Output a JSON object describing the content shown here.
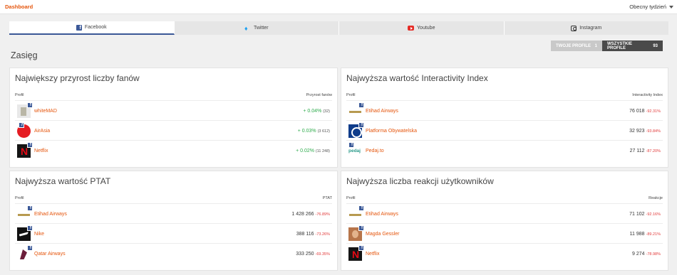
{
  "header": {
    "breadcrumb": "Dashboard",
    "period": "Obecny tydzień"
  },
  "tabs": [
    {
      "label": "Facebook",
      "icon": "facebook-icon",
      "active": true
    },
    {
      "label": "Twitter",
      "icon": "twitter-icon",
      "active": false
    },
    {
      "label": "Youtube",
      "icon": "youtube-icon",
      "active": false
    },
    {
      "label": "Instagram",
      "icon": "instagram-icon",
      "active": false
    }
  ],
  "toggle": {
    "own": {
      "label": "TWOJE PROFILE",
      "count": "1"
    },
    "all": {
      "label": "WSZYSTKIE PROFILE",
      "count": "93"
    }
  },
  "section_title": "Zasięg",
  "cards": [
    {
      "title": "Największy przyrost liczby fanów",
      "col_left": "Profil",
      "col_right": "Przyrost fanów",
      "rows": [
        {
          "name": "whiteMAD",
          "avatar": "whitemad-avatar",
          "value": "+ 0.04%",
          "aux": "(32)"
        },
        {
          "name": "AirAsia",
          "avatar": "airasia-avatar",
          "value": "+ 0.03%",
          "aux": "(3 612)"
        },
        {
          "name": "Netflix",
          "avatar": "netflix-avatar",
          "value": "+ 0.02%",
          "aux": "(11 248)"
        }
      ]
    },
    {
      "title": "Najwyższa wartość Interactivity Index",
      "col_left": "Profil",
      "col_right": "Interactivity Index",
      "rows": [
        {
          "name": "Etihad Airways",
          "avatar": "etihad-avatar",
          "value": "76 018",
          "change": "-92.31%"
        },
        {
          "name": "Platforma Obywatelska",
          "avatar": "platforma-avatar",
          "value": "32 923",
          "change": "-93.84%"
        },
        {
          "name": "Pedaj.to",
          "avatar": "pedaj-avatar",
          "value": "27 112",
          "change": "-87.20%"
        }
      ]
    },
    {
      "title": "Najwyższa wartość PTAT",
      "col_left": "Profil",
      "col_right": "PTAT",
      "rows": [
        {
          "name": "Etihad Airways",
          "avatar": "etihad-avatar",
          "value": "1 428 266",
          "change": "-76.89%"
        },
        {
          "name": "Nike",
          "avatar": "nike-avatar",
          "value": "388 116",
          "change": "-73.26%"
        },
        {
          "name": "Qatar Airways",
          "avatar": "qatar-avatar",
          "value": "333 250",
          "change": "-69.35%"
        }
      ]
    },
    {
      "title": "Najwyższa liczba reakcji użytkowników",
      "col_left": "Profil",
      "col_right": "Reakcje",
      "rows": [
        {
          "name": "Etihad Airways",
          "avatar": "etihad-avatar",
          "value": "71 102",
          "change": "-92.16%"
        },
        {
          "name": "Magda Gessler",
          "avatar": "magda-avatar",
          "value": "11 988",
          "change": "-89.21%"
        },
        {
          "name": "Netflix",
          "avatar": "netflix-avatar",
          "value": "9 274",
          "change": "-78.98%"
        }
      ]
    }
  ]
}
